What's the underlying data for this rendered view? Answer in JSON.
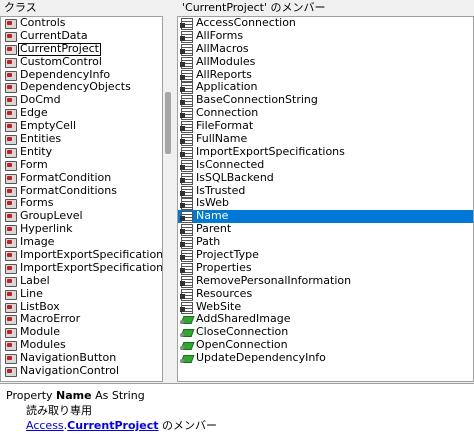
{
  "headers": {
    "left": "クラス",
    "right": "'CurrentProject' のメンバー"
  },
  "classes": [
    {
      "label": "Controls"
    },
    {
      "label": "CurrentData"
    },
    {
      "label": "CurrentProject",
      "selected": true
    },
    {
      "label": "CustomControl"
    },
    {
      "label": "DependencyInfo"
    },
    {
      "label": "DependencyObjects"
    },
    {
      "label": "DoCmd"
    },
    {
      "label": "Edge"
    },
    {
      "label": "EmptyCell"
    },
    {
      "label": "Entities"
    },
    {
      "label": "Entity"
    },
    {
      "label": "Form"
    },
    {
      "label": "FormatCondition"
    },
    {
      "label": "FormatConditions"
    },
    {
      "label": "Forms"
    },
    {
      "label": "GroupLevel"
    },
    {
      "label": "Hyperlink"
    },
    {
      "label": "Image"
    },
    {
      "label": "ImportExportSpecification"
    },
    {
      "label": "ImportExportSpecifications"
    },
    {
      "label": "Label"
    },
    {
      "label": "Line"
    },
    {
      "label": "ListBox"
    },
    {
      "label": "MacroError"
    },
    {
      "label": "Module"
    },
    {
      "label": "Modules"
    },
    {
      "label": "NavigationButton"
    },
    {
      "label": "NavigationControl"
    }
  ],
  "members": [
    {
      "label": "AccessConnection",
      "icon": "property-icon"
    },
    {
      "label": "AllForms",
      "icon": "property-icon"
    },
    {
      "label": "AllMacros",
      "icon": "property-icon"
    },
    {
      "label": "AllModules",
      "icon": "property-icon"
    },
    {
      "label": "AllReports",
      "icon": "property-icon"
    },
    {
      "label": "Application",
      "icon": "property-icon"
    },
    {
      "label": "BaseConnectionString",
      "icon": "property-icon"
    },
    {
      "label": "Connection",
      "icon": "property-icon"
    },
    {
      "label": "FileFormat",
      "icon": "property-icon"
    },
    {
      "label": "FullName",
      "icon": "property-icon"
    },
    {
      "label": "ImportExportSpecifications",
      "icon": "property-icon"
    },
    {
      "label": "IsConnected",
      "icon": "property-icon"
    },
    {
      "label": "IsSQLBackend",
      "icon": "property-icon"
    },
    {
      "label": "IsTrusted",
      "icon": "property-icon"
    },
    {
      "label": "IsWeb",
      "icon": "property-icon"
    },
    {
      "label": "Name",
      "icon": "property-icon",
      "highlighted": true
    },
    {
      "label": "Parent",
      "icon": "property-icon"
    },
    {
      "label": "Path",
      "icon": "property-icon"
    },
    {
      "label": "ProjectType",
      "icon": "property-icon"
    },
    {
      "label": "Properties",
      "icon": "property-icon"
    },
    {
      "label": "RemovePersonalInformation",
      "icon": "property-icon"
    },
    {
      "label": "Resources",
      "icon": "property-icon"
    },
    {
      "label": "WebSite",
      "icon": "property-icon"
    },
    {
      "label": "AddSharedImage",
      "icon": "method-icon"
    },
    {
      "label": "CloseConnection",
      "icon": "method-icon"
    },
    {
      "label": "OpenConnection",
      "icon": "method-icon"
    },
    {
      "label": "UpdateDependencyInfo",
      "icon": "method-icon"
    }
  ],
  "detail": {
    "prefix": "Property ",
    "name": "Name",
    "suffix": " As String",
    "readonly": "読み取り専用",
    "link_library": "Access",
    "link_sep": ".",
    "link_class": "CurrentProject",
    "member_of": " のメンバー"
  }
}
